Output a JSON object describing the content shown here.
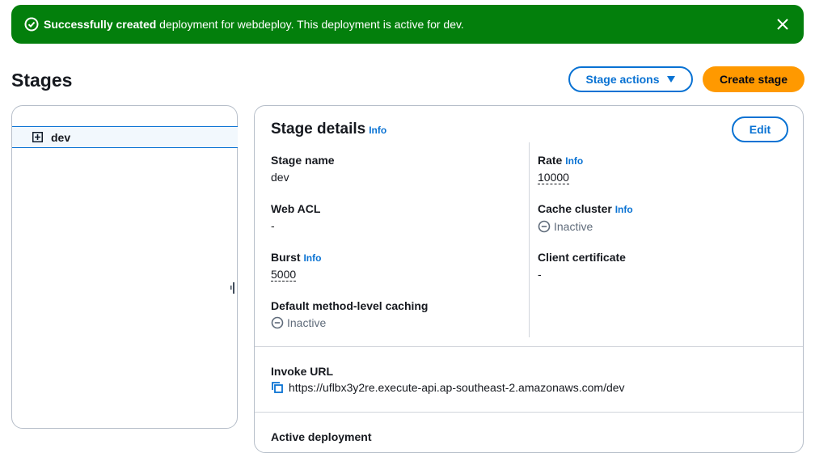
{
  "flash": {
    "bold": "Successfully created",
    "message": " deployment for webdeploy. This deployment is active for dev."
  },
  "page": {
    "title": "Stages",
    "stage_actions_label": "Stage actions",
    "create_stage_label": "Create stage"
  },
  "tree": {
    "items": [
      {
        "label": "dev"
      }
    ]
  },
  "details": {
    "title": "Stage details",
    "info_label": "Info",
    "edit_label": "Edit",
    "left_fields": [
      {
        "key": "Stage name",
        "value": "dev"
      },
      {
        "key": "Web ACL",
        "value": "-"
      },
      {
        "key": "Burst",
        "value": "5000"
      },
      {
        "key": "Default method-level caching",
        "value": "Inactive"
      }
    ],
    "right_fields": [
      {
        "key": "Rate",
        "value": "10000"
      },
      {
        "key": "Cache cluster",
        "value": "Inactive"
      },
      {
        "key": "Client certificate",
        "value": "-"
      }
    ],
    "invoke_url_label": "Invoke URL",
    "invoke_url": "https://uflbx3y2re.execute-api.ap-southeast-2.amazonaws.com/dev",
    "active_deployment_label": "Active deployment"
  },
  "colors": {
    "success": "#037f0c",
    "link": "#0972d3",
    "primary": "#ff9900"
  }
}
